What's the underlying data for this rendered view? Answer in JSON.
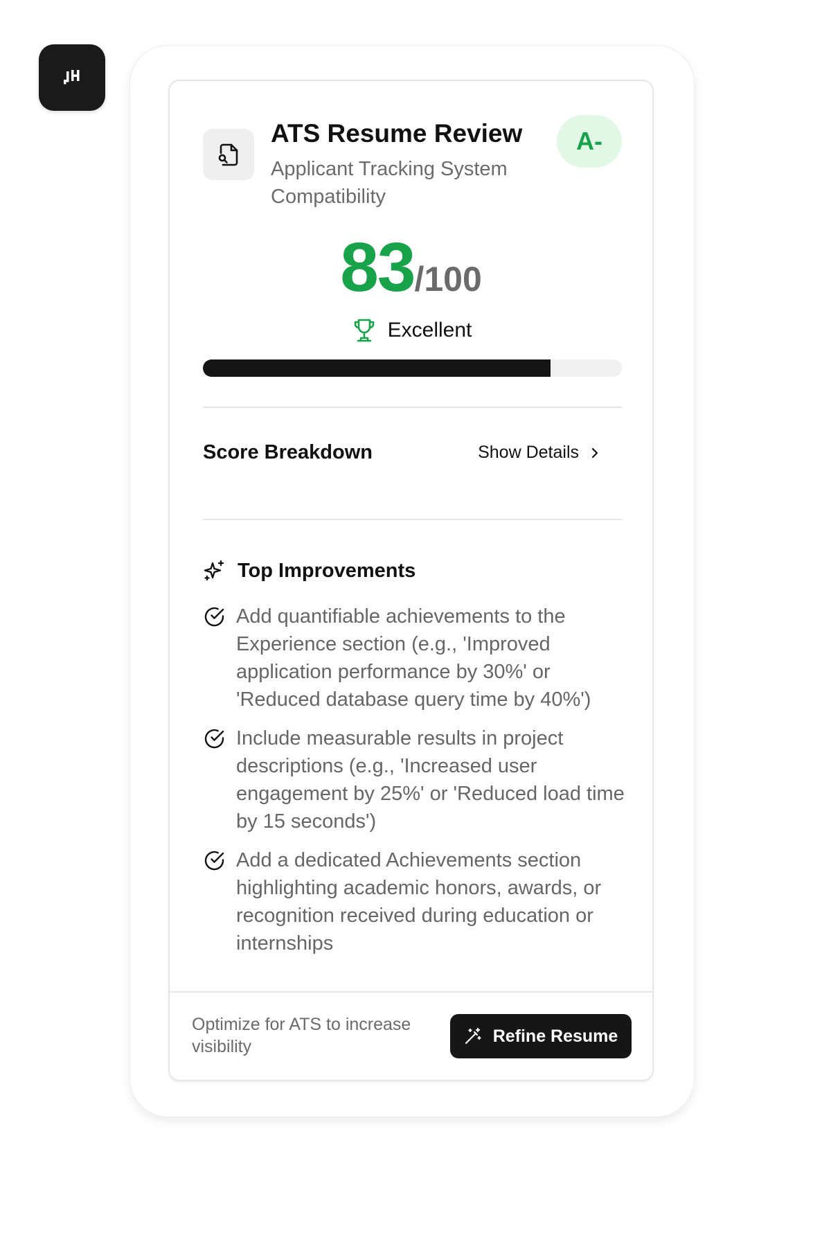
{
  "logo": {
    "icon": "jh-logo-icon"
  },
  "review": {
    "title": "ATS Resume Review",
    "subtitle": "Applicant Tracking System Compatibility",
    "grade": "A-",
    "score": "83",
    "score_max": "/100",
    "rating": "Excellent",
    "progress_percent": 83
  },
  "breakdown": {
    "title": "Score Breakdown",
    "toggle_label": "Show Details"
  },
  "improvements": {
    "title": "Top Improvements",
    "items": [
      "Add quantifiable achievements to the Experience section (e.g., 'Improved application performance by 30%' or 'Reduced database query time by 40%')",
      "Include measurable results in project descriptions (e.g., 'Increased user engagement by 25%' or 'Reduced load time by 15 seconds')",
      "Add a dedicated Achievements section highlighting academic honors, awards, or recognition received during education or internships"
    ]
  },
  "footer": {
    "note": "Optimize for ATS to increase visibility",
    "button_label": "Refine Resume"
  },
  "colors": {
    "accent_green": "#18a34a",
    "grade_bg": "#e3f7e6",
    "dark": "#161616"
  }
}
